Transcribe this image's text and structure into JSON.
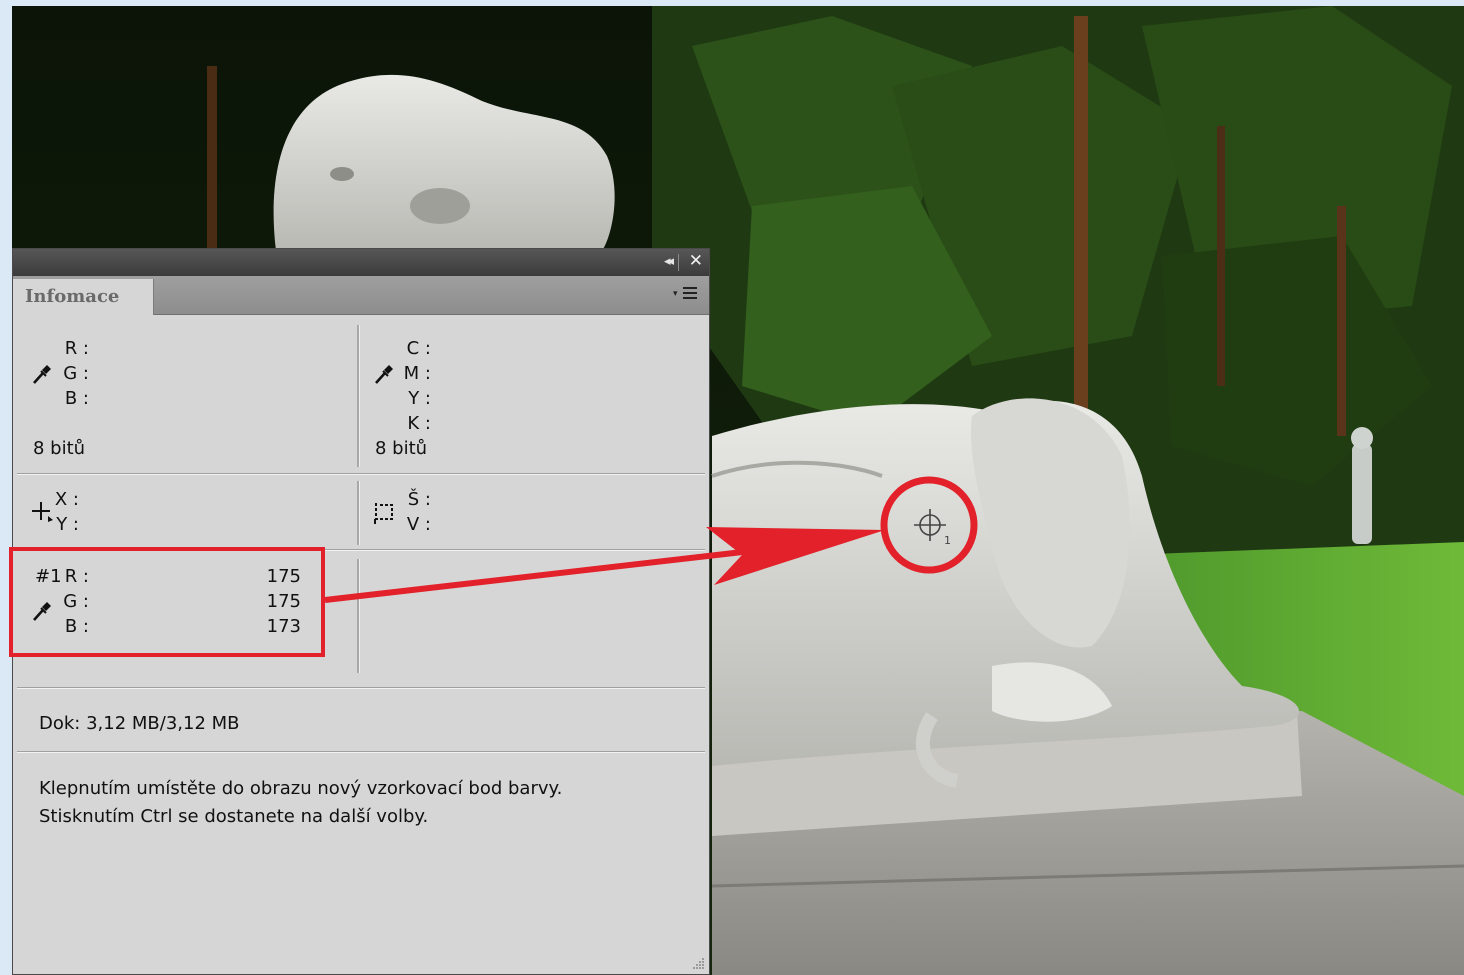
{
  "panel": {
    "tab_label": "Infomace",
    "collapse_label": "◂◂",
    "close_label": "✕",
    "rgb": {
      "r": "R :",
      "g": "G :",
      "b": "B :",
      "depth": "8 bitů"
    },
    "cmyk": {
      "c": "C :",
      "m": "M :",
      "y": "Y :",
      "k": "K :",
      "depth": "8 bitů"
    },
    "position": {
      "x": "X :",
      "y": "Y :"
    },
    "size": {
      "w": "Š :",
      "h": "V :"
    },
    "sampler": {
      "prefix": "#1",
      "r": "R :",
      "g": "G :",
      "b": "B :",
      "r_value": "175",
      "g_value": "175",
      "b_value": "173"
    },
    "doc": "Dok: 3,12 MB/3,12 MB",
    "hint_line1": "Klepnutím umístěte do obrazu nový vzorkovací bod barvy.",
    "hint_line2": "Stisknutím Ctrl se dostanete na další volby."
  },
  "sampler_marker": {
    "number": "1"
  },
  "colors": {
    "highlight": "#e3212a",
    "panel": "#d6d6d6",
    "titlebar": "#444444"
  },
  "icons": [
    "eyedropper-icon",
    "crosshair-icon",
    "selection-size-icon",
    "panel-menu-icon",
    "color-sampler-icon"
  ]
}
